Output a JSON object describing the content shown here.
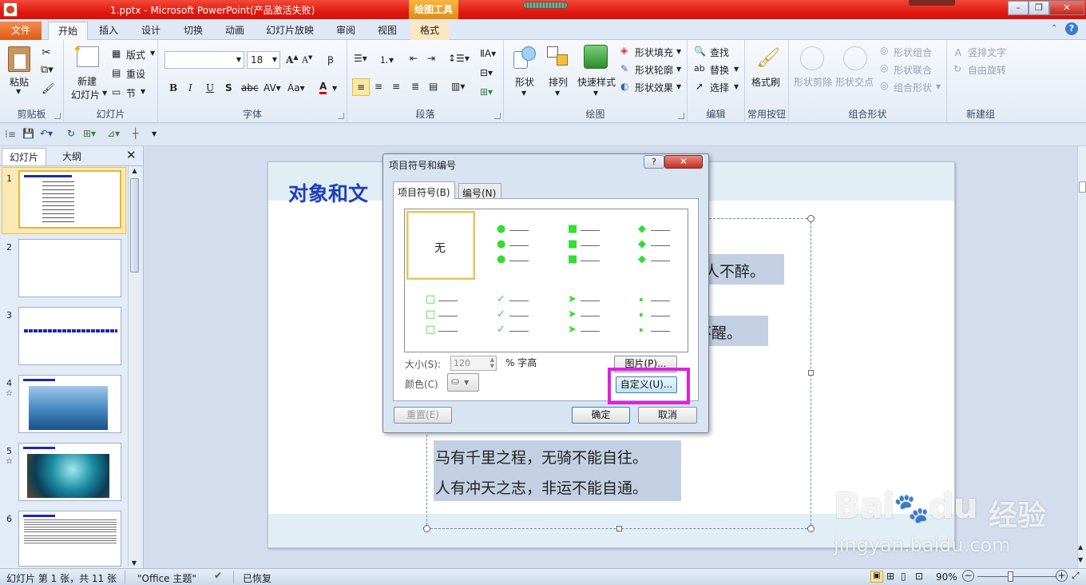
{
  "title_bar": {
    "title": "1.pptx - Microsoft PowerPoint(产品激活失败)",
    "tool_tag": "绘图工具"
  },
  "tabs": [
    {
      "label": "文件"
    },
    {
      "label": "开始"
    },
    {
      "label": "插入"
    },
    {
      "label": "设计"
    },
    {
      "label": "切换"
    },
    {
      "label": "动画"
    },
    {
      "label": "幻灯片放映"
    },
    {
      "label": "审阅"
    },
    {
      "label": "视图"
    },
    {
      "label": "格式"
    }
  ],
  "ribbon": {
    "clipboard": {
      "paste": "粘贴",
      "label": "剪贴板"
    },
    "slides": {
      "new_slide_1": "新建",
      "new_slide_2": "幻灯片",
      "layout": "版式",
      "reset": "重设",
      "section": "节",
      "label": "幻灯片"
    },
    "font": {
      "font_size": "18",
      "label": "字体"
    },
    "paragraph": {
      "label": "段落"
    },
    "drawing": {
      "shape": "形状",
      "arrange": "排列",
      "quick_styles": "快速样式",
      "fill": "形状填充",
      "outline": "形状轮廓",
      "effects": "形状效果",
      "label": "绘图"
    },
    "editing": {
      "find": "查找",
      "replace": "替换",
      "select": "选择",
      "label": "编辑"
    },
    "common": {
      "format_painter": "格式刷",
      "label": "常用按钮"
    },
    "combine": {
      "subtract": "形状剪除",
      "intersect": "形状交点",
      "union": "形状组合",
      "combine": "形状联合",
      "fragment": "组合形状",
      "label": "组合形状"
    },
    "new_group": {
      "vertical_text": "竖排文字",
      "free_rotate": "自由旋转",
      "label": "新建组"
    }
  },
  "left_pane": {
    "tab_slides": "幻灯片",
    "tab_outline": "大纲",
    "slide_numbers": [
      "1",
      "2",
      "3",
      "4",
      "5",
      "6"
    ]
  },
  "slide": {
    "title": "对象和文",
    "line1_tail": "人不醉。",
    "line2_tail": "不醒。",
    "line3": "马有千里之程，无骑不能自往。",
    "line4": "人有冲天之志，非运不能自通。"
  },
  "dialog": {
    "title": "项目符号和编号",
    "help": "?",
    "tab_bullets": "项目符号(B)",
    "tab_numbering": "编号(N)",
    "none_label": "无",
    "size_label": "大小(S):",
    "size_value": "120",
    "size_unit": "% 字高",
    "color_label": "颜色(C)",
    "picture_button": "图片(P)...",
    "customize_button": "自定义(U)...",
    "reset_button": "重置(E)",
    "ok_button": "确定",
    "cancel_button": "取消",
    "bullet_color": "#33dd33",
    "highlight_color": "#e020e0"
  },
  "status_bar": {
    "slide_info": "幻灯片 第 1 张，共 11 张",
    "theme": "\"Office 主题\"",
    "recovered": "已恢复",
    "zoom": "90%"
  },
  "watermark": {
    "brand": "Bai",
    "brand2": "du",
    "cn": "经验",
    "url": "jingyan.baidu.com"
  }
}
